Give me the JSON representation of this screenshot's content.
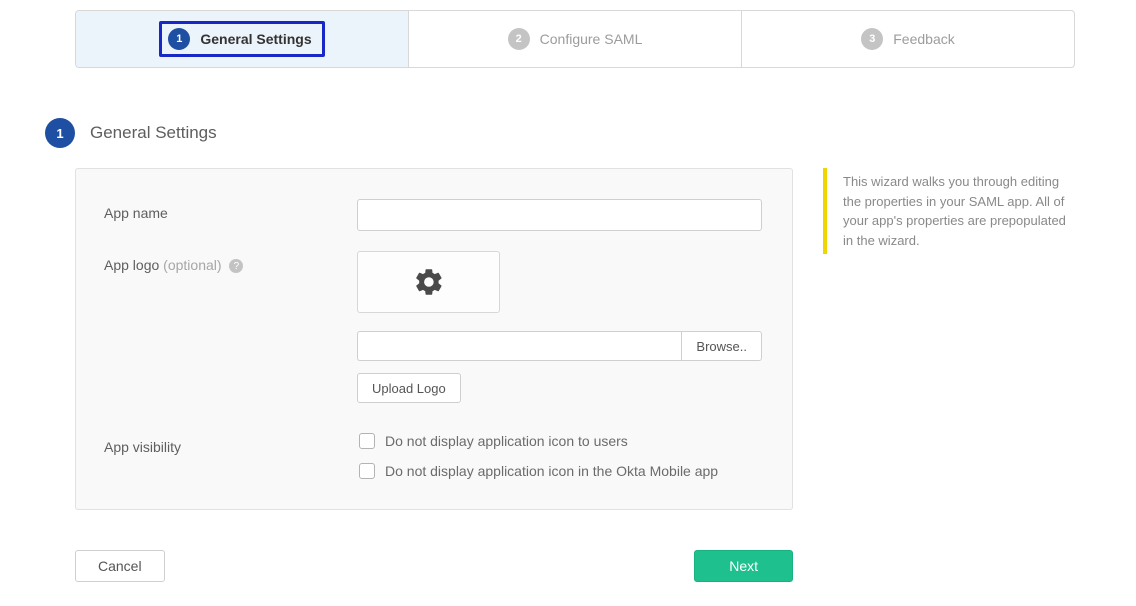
{
  "wizard": {
    "steps": [
      {
        "num": "1",
        "label": "General Settings"
      },
      {
        "num": "2",
        "label": "Configure SAML"
      },
      {
        "num": "3",
        "label": "Feedback"
      }
    ]
  },
  "section": {
    "num": "1",
    "title": "General Settings"
  },
  "form": {
    "app_name_label": "App name",
    "app_name_value": "",
    "app_logo_label": "App logo",
    "optional_text": " (optional) ",
    "help_glyph": "?",
    "browse_label": "Browse..",
    "upload_label": "Upload Logo",
    "visibility_label": "App visibility",
    "vis_opt1": "Do not display application icon to users",
    "vis_opt2": "Do not display application icon in the Okta Mobile app"
  },
  "info": {
    "text": "This wizard walks you through editing the properties in your SAML app. All of your app's properties are prepopulated in the wizard."
  },
  "footer": {
    "cancel": "Cancel",
    "next": "Next"
  }
}
